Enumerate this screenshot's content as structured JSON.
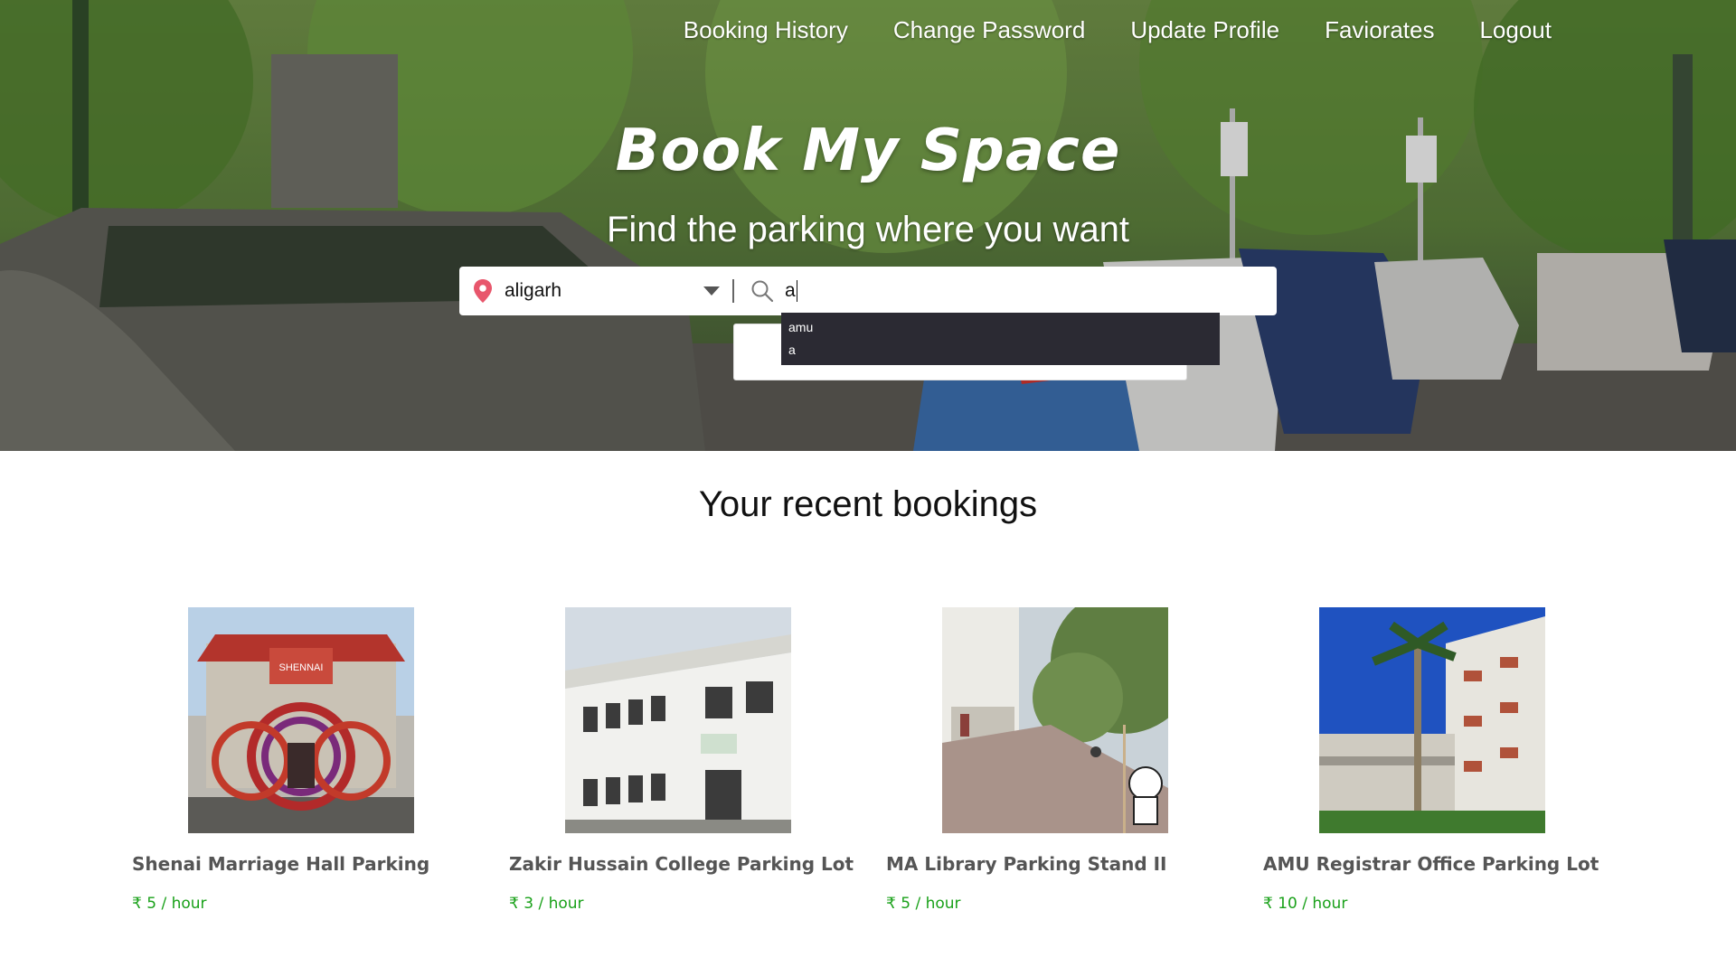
{
  "nav": {
    "items": [
      "Booking History",
      "Change Password",
      "Update Profile",
      "Faviorates",
      "Logout"
    ]
  },
  "hero": {
    "title": "Book My Space",
    "tagline": "Find the parking where you want"
  },
  "search": {
    "city_value": "aligarh",
    "query_value": "a",
    "suggestions": [
      "amu",
      "a"
    ]
  },
  "recent": {
    "title": "Your recent bookings",
    "cards": [
      {
        "name": "Shenai Marriage Hall Parking",
        "price": "₹ 5 / hour",
        "sign": "SHENNAI"
      },
      {
        "name": "Zakir Hussain College Parking Lot",
        "price": "₹ 3 / hour"
      },
      {
        "name": "MA Library Parking Stand II",
        "price": "₹ 5 / hour"
      },
      {
        "name": "AMU Registrar Office Parking Lot",
        "price": "₹ 10 / hour"
      }
    ]
  },
  "colors": {
    "price": "#1aa11a",
    "pin": "#e8566c",
    "suggest_bg": "#2b2a33"
  }
}
